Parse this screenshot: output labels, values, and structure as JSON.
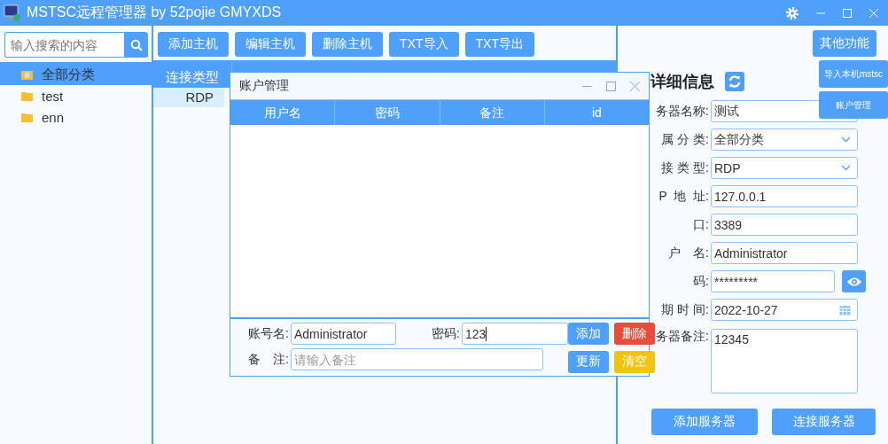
{
  "window": {
    "title": "MSTSC远程管理器 by 52pojie GMYXDS"
  },
  "search": {
    "placeholder": "输入搜索的内容"
  },
  "toolbar": [
    "添加主机",
    "编辑主机",
    "删除主机",
    "TXT导入",
    "TXT导出"
  ],
  "other_button": "其他功能",
  "other_menu": [
    "导入本机mstsc",
    "账户管理"
  ],
  "sidebar": {
    "items": [
      {
        "label": "全部分类",
        "kind": "all",
        "selected": true
      },
      {
        "label": "test",
        "kind": "folder",
        "selected": false
      },
      {
        "label": "enn",
        "kind": "folder",
        "selected": false
      }
    ]
  },
  "table": {
    "columns": [
      "连接类型"
    ],
    "rows": [
      {
        "cells": [
          "RDP"
        ],
        "selected": true
      }
    ]
  },
  "dialog": {
    "title": "账户管理",
    "columns": [
      "用户名",
      "密码",
      "备注",
      "id"
    ],
    "account_label": "账号名:",
    "account_value": "Administrator",
    "password_label": "密码:",
    "password_value": "123",
    "note_label": "备　注:",
    "note_placeholder": "请输入备注",
    "buttons": [
      {
        "label": "添加",
        "kind": "primary"
      },
      {
        "label": "删除",
        "kind": "danger"
      },
      {
        "label": "更新",
        "kind": "primary"
      },
      {
        "label": "清空",
        "kind": "warning"
      }
    ]
  },
  "details": {
    "title": "详细信息",
    "fields": [
      {
        "label": "务器名称:",
        "value": "测试",
        "kind": "text"
      },
      {
        "label": "属 分 类:",
        "value": "全部分类",
        "kind": "select"
      },
      {
        "label": "接 类 型:",
        "value": "RDP",
        "kind": "select"
      },
      {
        "label": "P  地  址:",
        "value": "127.0.0.1",
        "kind": "text"
      },
      {
        "label": "口:",
        "value": "3389",
        "kind": "text"
      },
      {
        "label": "户　名:",
        "value": "Administrator",
        "kind": "text"
      },
      {
        "label": "码:",
        "value": "*********",
        "kind": "password"
      },
      {
        "label": "期 时 间:",
        "value": "2022-10-27",
        "kind": "date"
      },
      {
        "label": "务器备注:",
        "value": "12345",
        "kind": "textarea"
      }
    ],
    "buttons": [
      "添加服务器",
      "连接服务器"
    ]
  }
}
